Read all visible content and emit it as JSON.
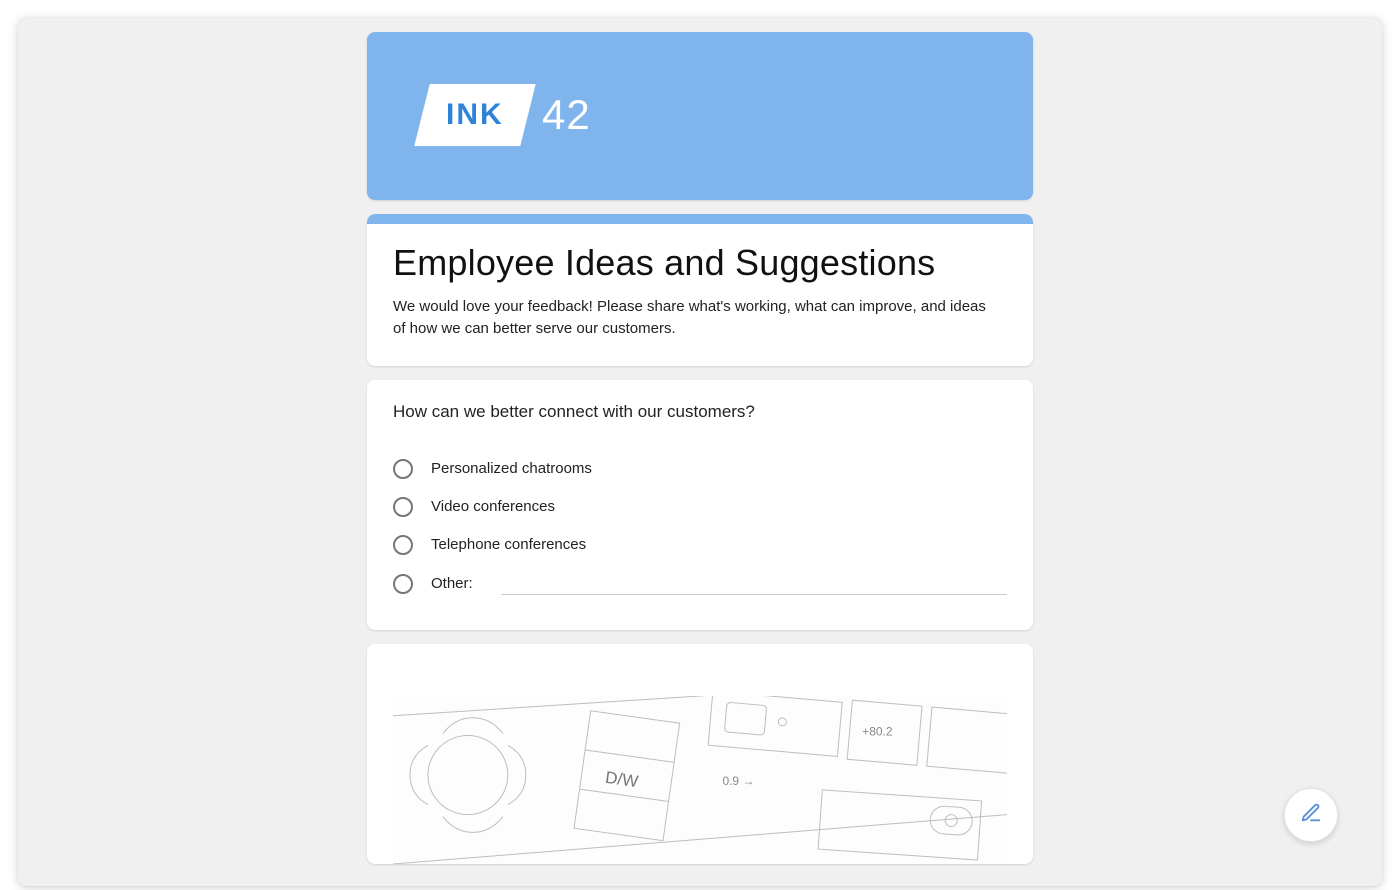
{
  "brand": {
    "logo_text": "INK",
    "logo_number": "42"
  },
  "form": {
    "title": "Employee Ideas and Suggestions",
    "description": "We would love your feedback! Please share what's working, what can improve, and ideas of how we can better serve our customers."
  },
  "question1": {
    "title": "How can we better connect with our customers?",
    "options": [
      "Personalized chatrooms",
      "Video conferences",
      "Telephone conferences"
    ],
    "other_label": "Other:"
  },
  "image_card": {
    "alt": "Floor plan sketch image"
  },
  "fab": {
    "name": "edit"
  },
  "colors": {
    "accent": "#7fb5ec"
  }
}
